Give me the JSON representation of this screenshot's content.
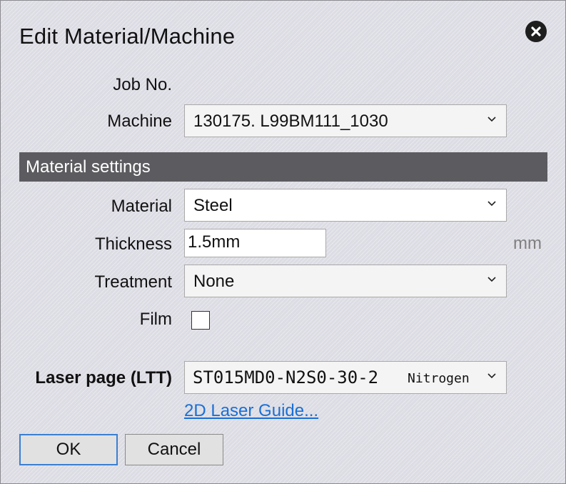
{
  "dialog": {
    "title": "Edit Material/Machine"
  },
  "fields": {
    "job_no_label": "Job No.",
    "machine_label": "Machine",
    "machine_value": "130175. L99BM111_1030",
    "section_title": "Material settings",
    "material_label": "Material",
    "material_value": "Steel",
    "thickness_label": "Thickness",
    "thickness_value": "1.5mm",
    "thickness_unit": "mm",
    "treatment_label": "Treatment",
    "treatment_value": "None",
    "film_label": "Film",
    "film_checked": false,
    "laser_page_label": "Laser page (LTT)",
    "laser_page_value": "ST015MD0-N2S0-30-2",
    "laser_page_gas": "Nitrogen",
    "guide_link": "2D Laser Guide..."
  },
  "buttons": {
    "ok_label": "OK",
    "cancel_label": "Cancel"
  },
  "icons": {
    "close": "close-circle-icon",
    "dropdown": "chevron-down-icon"
  },
  "colors": {
    "section_bg": "#5c5c60",
    "link": "#1a6fd4",
    "default_button_border": "#3b7fd1"
  }
}
